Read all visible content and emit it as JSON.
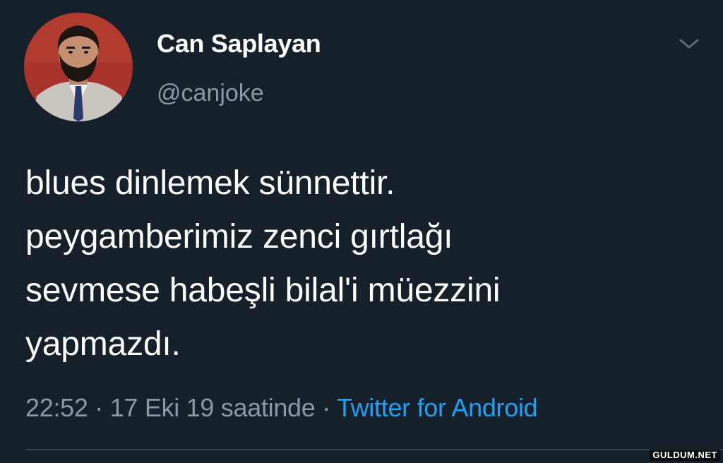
{
  "tweet": {
    "author": {
      "display_name": "Can Saplayan",
      "handle": "@canjoke",
      "avatar_icon": "profile-photo"
    },
    "menu_icon": "chevron-down-icon",
    "text_lines": [
      "blues dinlemek sünnettir.",
      "peygamberimiz zenci gırtlağı",
      "sevmese habeşli bilal'i müezzini",
      "yapmazdı."
    ],
    "meta": {
      "time": "22:52",
      "separator": " · ",
      "date": "17 Eki 19 saatinde",
      "source": "Twitter for Android"
    }
  },
  "watermark": "GULDUM.NET",
  "colors": {
    "background": "#15202b",
    "text_primary": "#ffffff",
    "text_secondary": "#8899a6",
    "link": "#1da1f2",
    "divider": "#38444d"
  }
}
